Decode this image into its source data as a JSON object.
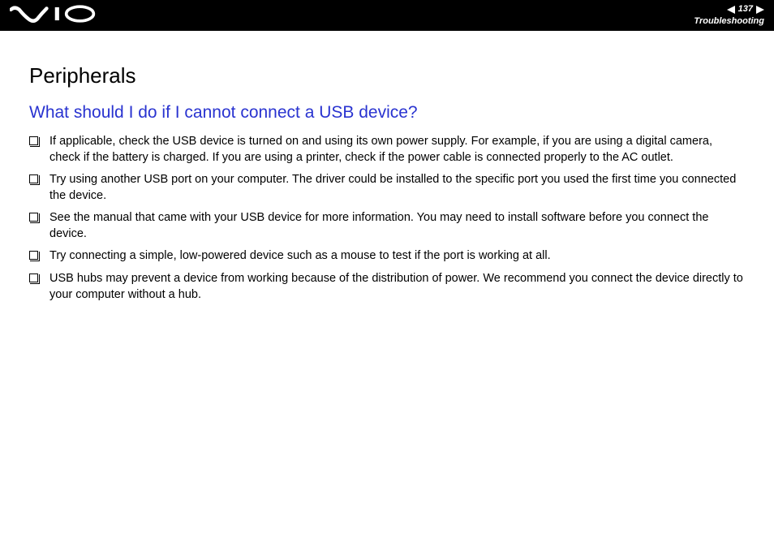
{
  "header": {
    "page_number": "137",
    "section_label": "Troubleshooting"
  },
  "content": {
    "section_title": "Peripherals",
    "question_title": "What should I do if I cannot connect a USB device?",
    "bullets": [
      "If applicable, check the USB device is turned on and using its own power supply. For example, if you are using a digital camera, check if the battery is charged. If you are using a printer, check if the power cable is connected properly to the AC outlet.",
      "Try using another USB port on your computer. The driver could be installed to the specific port you used the first time you connected the device.",
      "See the manual that came with your USB device for more information. You may need to install software before you connect the device.",
      "Try connecting a simple, low-powered device such as a mouse to test if the port is working at all.",
      "USB hubs may prevent a device from working because of the distribution of power. We recommend you connect the device directly to your computer without a hub."
    ]
  }
}
